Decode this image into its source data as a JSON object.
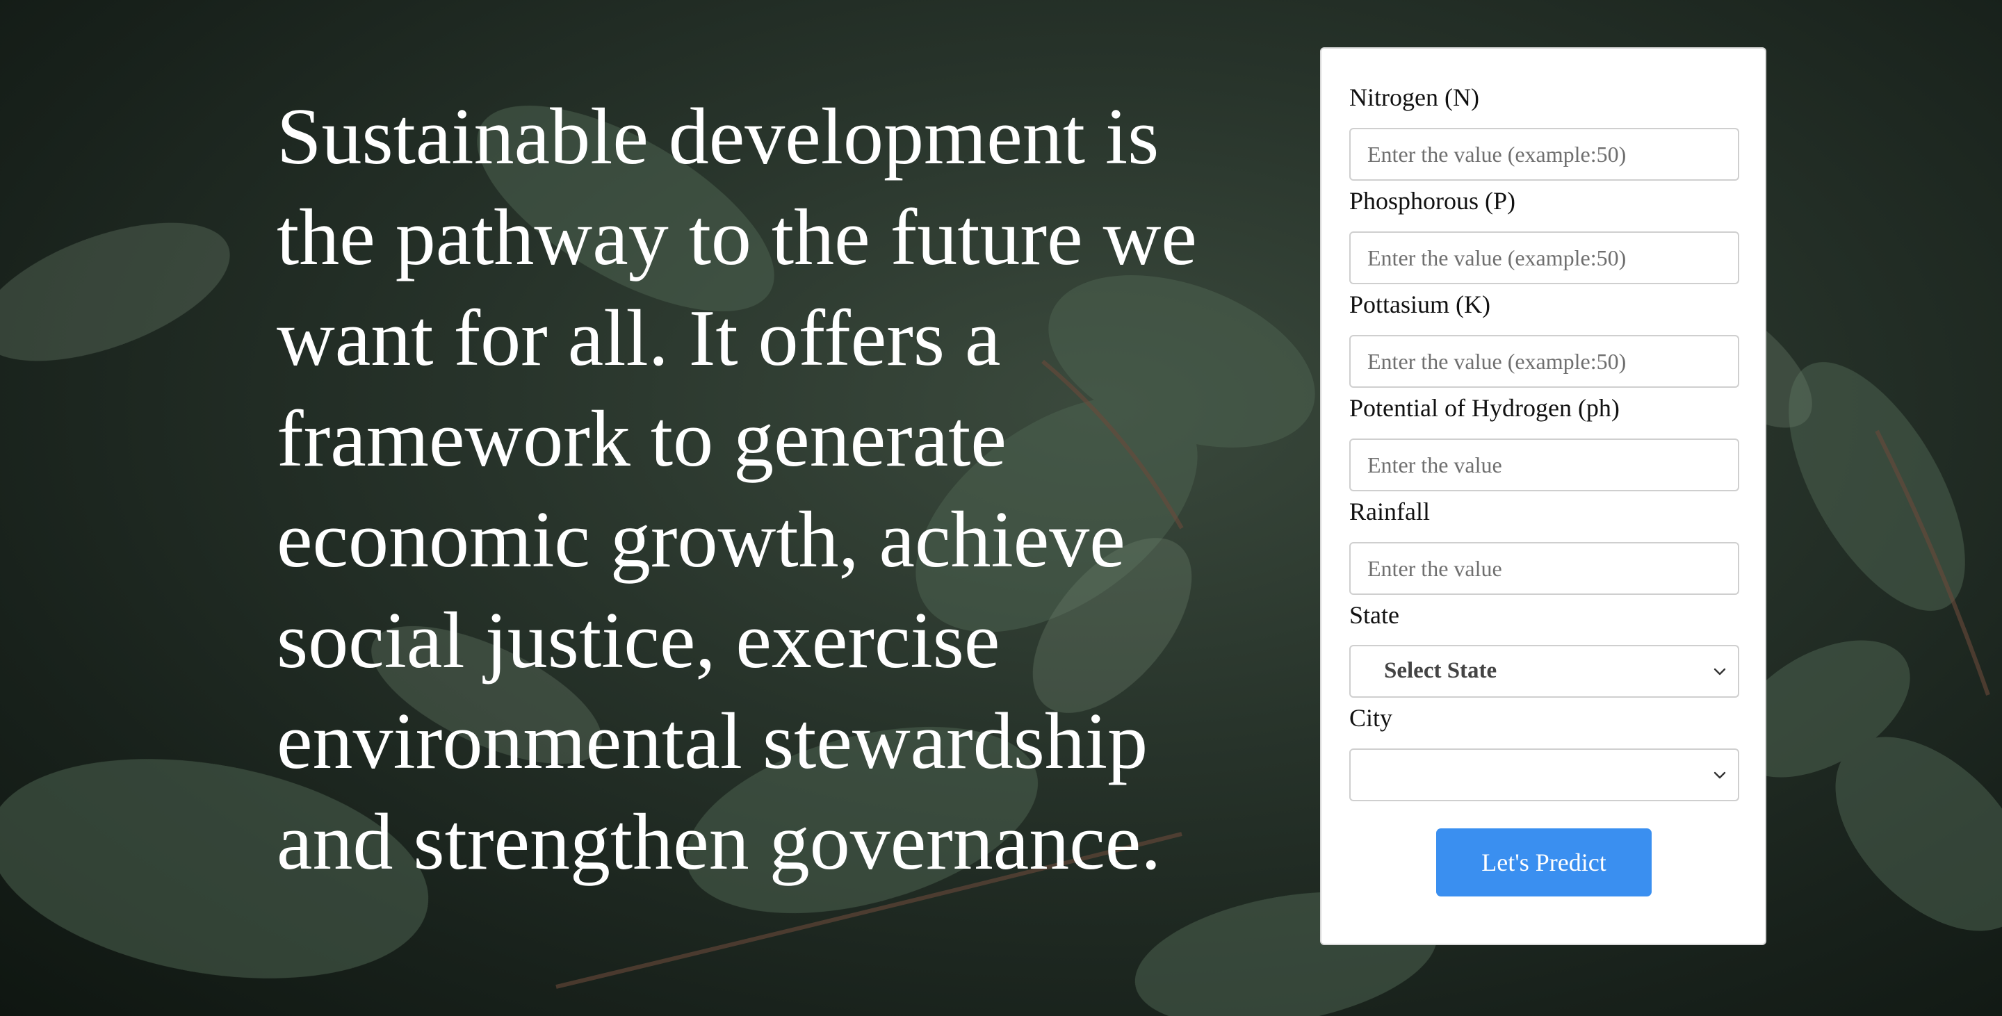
{
  "hero": {
    "quote": "Sustainable development is the pathway to the future we want for all. It offers a framework to generate economic growth, achieve social justice, exercise environmental stewardship and strengthen governance."
  },
  "form": {
    "nitrogen": {
      "label": "Nitrogen (N)",
      "placeholder": "Enter the value (example:50)",
      "value": ""
    },
    "phosphorous": {
      "label": "Phosphorous (P)",
      "placeholder": "Enter the value (example:50)",
      "value": ""
    },
    "potassium": {
      "label": "Pottasium (K)",
      "placeholder": "Enter the value (example:50)",
      "value": ""
    },
    "ph": {
      "label": "Potential of Hydrogen (ph)",
      "placeholder": "Enter the value",
      "value": ""
    },
    "rainfall": {
      "label": "Rainfall",
      "placeholder": "Enter the value",
      "value": ""
    },
    "state": {
      "label": "State",
      "selected": "Select State",
      "icon": "chevron-down-icon"
    },
    "city": {
      "label": "City",
      "selected": "",
      "icon": "chevron-down-icon"
    },
    "submit_label": "Let's Predict"
  },
  "colors": {
    "button": "#3a8ff0",
    "card": "#ffffff",
    "text_light": "#ffffff"
  }
}
